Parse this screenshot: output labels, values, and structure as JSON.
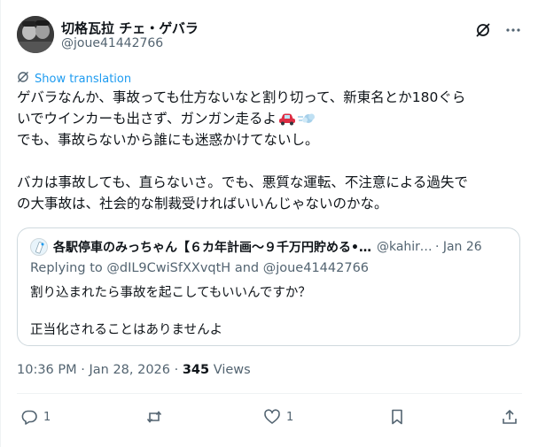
{
  "author": {
    "display_name": "切格瓦拉 チェ・ゲバラ",
    "handle": "@joue41442766"
  },
  "translate_label": "Show translation",
  "tweet_lines": [
    "ゲバラなんか、事故っても仕方ないなと割り切って、新東名とか180ぐら",
    "いでウインカーも出さず、ガンガン走るよ",
    "でも、事故らないから誰にも迷惑かけてないし。",
    "",
    "バカは事故しても、直らないさ。でも、悪質な運転、不注意による過失で",
    "の大事故は、社会的な制裁受ければいいんじゃないのかな。"
  ],
  "quote": {
    "name": "各駅停車のみっちゃん【６カ年計画〜９千万円貯める•…",
    "handle": "@kahiro…",
    "date": "· Jan 26",
    "replying_prefix": "Replying to",
    "replying_user1": "@dIL9CwiSfXXvqtH",
    "replying_and": "and",
    "replying_user2": "@joue41442766",
    "line1": "割り込まれたら事故を起こしてもいいんですか？",
    "line2": "正当化されることはありませんよ"
  },
  "meta": {
    "time_date": "10:36 PM · Jan 28, 2026 · ",
    "views_count": "345",
    "views_label": " Views"
  },
  "actions": {
    "reply_count": "1",
    "retweet_count": "",
    "like_count": "1"
  },
  "colors": {
    "accent": "#1d9bf0",
    "text": "#0f1419",
    "muted": "#536471",
    "border": "#cfd9de"
  },
  "icons": [
    "grok-icon",
    "more-icon",
    "translate-icon",
    "car-emoji",
    "dash-emoji",
    "reply-icon",
    "retweet-icon",
    "like-icon",
    "bookmark-icon",
    "share-icon"
  ]
}
